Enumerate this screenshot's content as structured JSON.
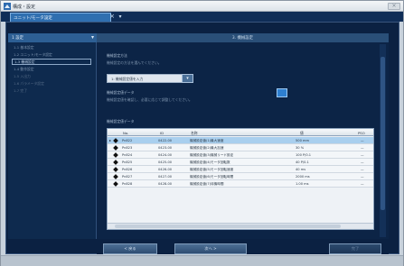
{
  "window": {
    "title": "構成・設定"
  },
  "tabs": [
    {
      "label": "ユニット/モータ設定"
    }
  ],
  "nav": {
    "header": "1 設定",
    "items": [
      {
        "label": "1-1 基本設定",
        "state": "normal"
      },
      {
        "label": "1-2 ユニット/モータ設定",
        "state": "normal"
      },
      {
        "label": "1-3 機械設定",
        "state": "selected"
      },
      {
        "label": "1-4 動作設定",
        "state": "normal"
      },
      {
        "label": "1-5 入出力",
        "state": "dim"
      },
      {
        "label": "1-6 パラメータ設定",
        "state": "dim"
      },
      {
        "label": "1-7 完了",
        "state": "dim"
      }
    ]
  },
  "main": {
    "header": "3. 機械設定",
    "section1": {
      "title": "機械設定方法",
      "description": "機械設定の方法を選んでください。"
    },
    "selection": {
      "value": "1: 機械設定値を入力"
    },
    "section2": {
      "title": "機械設定値データ",
      "description": "機械設定値を確認し、必要に応じて調整してください。"
    },
    "table_label": "機械設定値データ",
    "table": {
      "columns": [
        "No.",
        "ID",
        "名称",
        "値",
        "PSO"
      ],
      "rows": [
        {
          "no": "Pn822",
          "id": "0422-00",
          "name": "機械設定値(1)最大速度",
          "value": "500 mm",
          "pso": "—",
          "selected": true
        },
        {
          "no": "Pn823",
          "id": "0423-00",
          "name": "機械設定値(2)最大加速",
          "value": "30 %",
          "pso": "—"
        },
        {
          "no": "Pn824",
          "id": "0424-00",
          "name": "機械設定値(3)機械リード設定",
          "value": "100 P/0.1",
          "pso": "—"
        },
        {
          "no": "Pn825",
          "id": "0425-00",
          "name": "機械設定値(4)モータ回転数",
          "value": "40 P/0.1",
          "pso": "—"
        },
        {
          "no": "Pn826",
          "id": "0426-00",
          "name": "機械設定値(5)モータ回転速度",
          "value": "40 ms",
          "pso": "—"
        },
        {
          "no": "Pn827",
          "id": "0427-00",
          "name": "機械設定値(6)モータ回転時間",
          "value": "2000 ms",
          "pso": "—"
        },
        {
          "no": "Pn828",
          "id": "0428-00",
          "name": "機械設定値(7)待機時間",
          "value": "1.00 ms",
          "pso": "—"
        }
      ]
    }
  },
  "footer": {
    "back_label": "< 戻る",
    "next_label": "次へ >",
    "finish_label": "完了"
  },
  "colors": {
    "titlebar_bg": "#dde3e9",
    "tab_active": "#2f6fb0",
    "panel_bg": "#0c2446",
    "selected_row": "#a9cfee"
  }
}
